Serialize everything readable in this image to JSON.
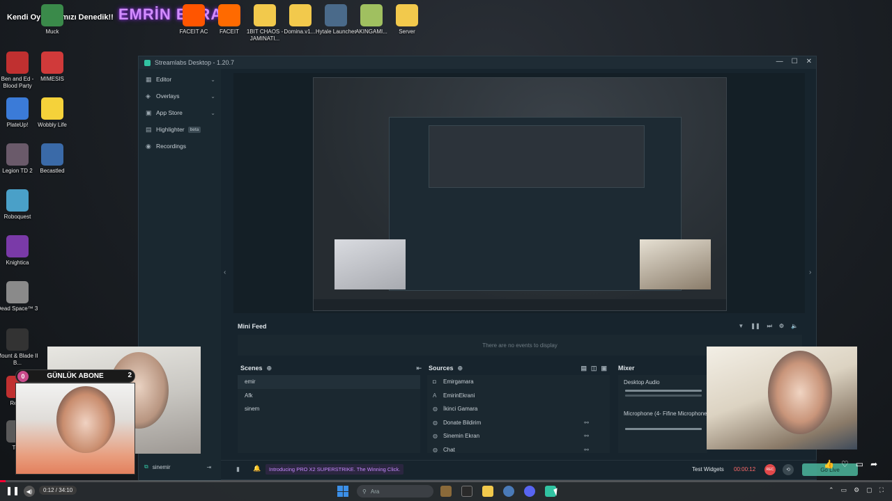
{
  "stream_overlay": {
    "title_small": "Kendi Oyunlarımızı Denedik!!",
    "title_big": "EMRİN EKRANI"
  },
  "desktop_icons": [
    {
      "label": "Muck",
      "color": "#3a8a4a"
    },
    {
      "label": "FACEIT AC",
      "color": "#ff5500"
    },
    {
      "label": "FACEIT",
      "color": "#ff6a00"
    },
    {
      "label": "1BIT CHAOS - JAMINATI...",
      "color": "#f2c94c"
    },
    {
      "label": "Domina.v1....",
      "color": "#f2c94c"
    },
    {
      "label": "Hytale Launcher",
      "color": "#4a6a8a"
    },
    {
      "label": "AKINGAMI...",
      "color": "#a0c060"
    },
    {
      "label": "Server",
      "color": "#f2c94c"
    },
    {
      "label": "Ben and Ed - Blood Party",
      "color": "#c03030"
    },
    {
      "label": "MIMESIS",
      "color": "#d03a3a"
    },
    {
      "label": "PlateUp!",
      "color": "#3b7bd8"
    },
    {
      "label": "Wobbly Life",
      "color": "#f5d23a"
    },
    {
      "label": "Legion TD 2",
      "color": "#6a5a6a"
    },
    {
      "label": "Becastled",
      "color": "#3a6aa8"
    },
    {
      "label": "Roboquest",
      "color": "#4aa0c8"
    },
    {
      "label": "Knightica",
      "color": "#7a3aa8"
    },
    {
      "label": "Dead Space™ 3",
      "color": "#8a8a8a"
    },
    {
      "label": "Mount & Blade II B...",
      "color": "#333333"
    },
    {
      "label": "Redm",
      "color": "#c03030"
    },
    {
      "label": "Torc",
      "color": "#5a5a5a"
    }
  ],
  "streamlabs": {
    "window_title": "Streamlabs Desktop - 1.20.7",
    "sidebar": [
      {
        "label": "Editor",
        "icon": "editor-icon"
      },
      {
        "label": "Overlays",
        "icon": "overlays-icon"
      },
      {
        "label": "App Store",
        "icon": "app-store-icon"
      },
      {
        "label": "Highlighter",
        "icon": "highlighter-icon",
        "badge": "beta"
      },
      {
        "label": "Recordings",
        "icon": "recordings-icon"
      }
    ],
    "mini_feed": {
      "title": "Mini Feed",
      "empty_text": "There are no events to display"
    },
    "scenes": {
      "title": "Scenes",
      "items": [
        "emir",
        "Afk",
        "sinem"
      ]
    },
    "sources": {
      "title": "Sources",
      "items": [
        {
          "label": "Emirgamara",
          "icon": "camera-icon",
          "linked": false
        },
        {
          "label": "EmirinEkrani",
          "icon": "text-icon",
          "linked": false
        },
        {
          "label": "İkinci Gamara",
          "icon": "globe-icon",
          "linked": false
        },
        {
          "label": "Donate Bildirim",
          "icon": "globe-icon",
          "linked": true
        },
        {
          "label": "Sinemin Ekran",
          "icon": "globe-icon",
          "linked": true
        },
        {
          "label": "Chat",
          "icon": "globe-icon",
          "linked": true
        }
      ]
    },
    "mixer": {
      "title": "Mixer",
      "items": [
        "Desktop Audio",
        "Microphone (4- Fifine Microphone)"
      ]
    },
    "footer": {
      "scene_collection": "sinemir",
      "promo": "Introducing PRO X2 SUPERSTRIKE. The Winning Click.",
      "test_widgets": "Test Widgets",
      "timer": "00:00:12",
      "rec_label": "REC",
      "go_live": "Go Live"
    }
  },
  "abone_widget": {
    "label": "GÜNLÜK ABONE",
    "left_count": "0",
    "right_count": "2"
  },
  "player": {
    "time": "0:12 / 34:10",
    "progress": 0.006,
    "search_placeholder": "Ara"
  }
}
